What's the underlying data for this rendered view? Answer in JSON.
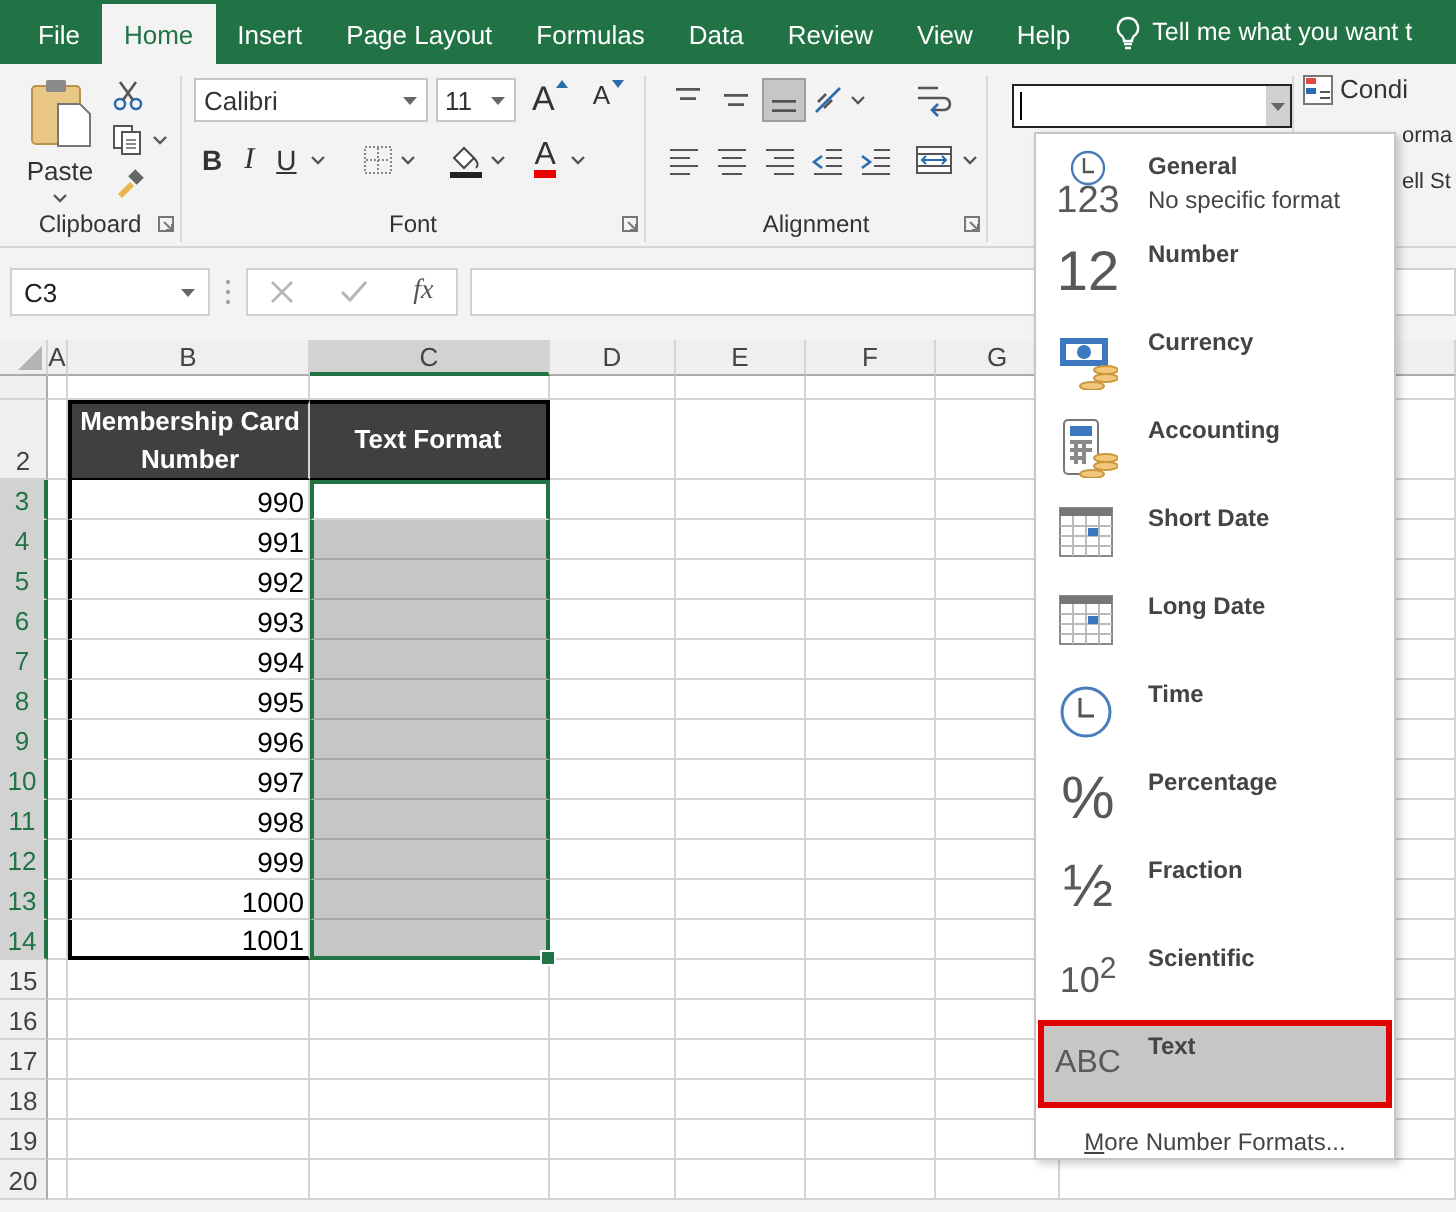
{
  "menu_tabs": [
    {
      "label": "File",
      "selected": false
    },
    {
      "label": "Home",
      "selected": true
    },
    {
      "label": "Insert",
      "selected": false
    },
    {
      "label": "Page Layout",
      "selected": false
    },
    {
      "label": "Formulas",
      "selected": false
    },
    {
      "label": "Data",
      "selected": false
    },
    {
      "label": "Review",
      "selected": false
    },
    {
      "label": "View",
      "selected": false
    },
    {
      "label": "Help",
      "selected": false
    }
  ],
  "tell_me": "Tell me what you want t",
  "ribbon": {
    "clipboard": {
      "paste": "Paste",
      "label": "Clipboard"
    },
    "font": {
      "name": "Calibri",
      "size": "11",
      "grow": "A",
      "shrink": "A",
      "bold": "B",
      "italic": "I",
      "underline": "U",
      "color_letter": "A",
      "label": "Font"
    },
    "alignment": {
      "label": "Alignment",
      "vertical_align": [
        {
          "kind": "top",
          "selected": false
        },
        {
          "kind": "middle",
          "selected": false
        },
        {
          "kind": "bottom",
          "selected": true
        }
      ]
    },
    "styles": [
      "Condi",
      "orma",
      "ell St"
    ]
  },
  "formula_bar": {
    "name_box": "C3",
    "fx": "fx"
  },
  "sheet": {
    "columns": [
      {
        "label": "A",
        "selected": false
      },
      {
        "label": "B",
        "selected": false
      },
      {
        "label": "C",
        "selected": true
      },
      {
        "label": "D",
        "selected": false
      },
      {
        "label": "E",
        "selected": false
      },
      {
        "label": "F",
        "selected": false
      },
      {
        "label": "G",
        "selected": false
      }
    ],
    "row_headers": [
      {
        "label": "2",
        "selected": false
      },
      {
        "label": "3",
        "selected": true
      },
      {
        "label": "4",
        "selected": true
      },
      {
        "label": "5",
        "selected": true
      },
      {
        "label": "6",
        "selected": true
      },
      {
        "label": "7",
        "selected": true
      },
      {
        "label": "8",
        "selected": true
      },
      {
        "label": "9",
        "selected": true
      },
      {
        "label": "10",
        "selected": true
      },
      {
        "label": "11",
        "selected": true
      },
      {
        "label": "12",
        "selected": true
      },
      {
        "label": "13",
        "selected": true
      },
      {
        "label": "14",
        "selected": true
      },
      {
        "label": "15",
        "selected": false
      },
      {
        "label": "16",
        "selected": false
      },
      {
        "label": "17",
        "selected": false
      },
      {
        "label": "18",
        "selected": false
      },
      {
        "label": "19",
        "selected": false
      },
      {
        "label": "20",
        "selected": false
      }
    ],
    "table": {
      "headers": [
        "Membership Card Number",
        "Text Format"
      ],
      "rows": [
        {
          "card_number": "990",
          "selected": true,
          "active": true
        },
        {
          "card_number": "991",
          "selected": true,
          "active": false
        },
        {
          "card_number": "992",
          "selected": true,
          "active": false
        },
        {
          "card_number": "993",
          "selected": true,
          "active": false
        },
        {
          "card_number": "994",
          "selected": true,
          "active": false
        },
        {
          "card_number": "995",
          "selected": true,
          "active": false
        },
        {
          "card_number": "996",
          "selected": true,
          "active": false
        },
        {
          "card_number": "997",
          "selected": true,
          "active": false
        },
        {
          "card_number": "998",
          "selected": true,
          "active": false
        },
        {
          "card_number": "999",
          "selected": true,
          "active": false
        },
        {
          "card_number": "1000",
          "selected": true,
          "active": false
        },
        {
          "card_number": "1001",
          "selected": true,
          "active": false
        }
      ]
    }
  },
  "format_menu": {
    "items": [
      {
        "kind": "general",
        "label": "General",
        "description": "No specific format",
        "glyph": "123",
        "selected": false
      },
      {
        "kind": "number",
        "label": "Number",
        "glyph": "12",
        "selected": false
      },
      {
        "kind": "currency",
        "label": "Currency",
        "selected": false
      },
      {
        "kind": "accounting",
        "label": "Accounting",
        "selected": false
      },
      {
        "kind": "short_date",
        "label": "Short Date",
        "selected": false
      },
      {
        "kind": "long_date",
        "label": "Long Date",
        "selected": false
      },
      {
        "kind": "time",
        "label": "Time",
        "selected": false
      },
      {
        "kind": "percentage",
        "label": "Percentage",
        "glyph": "%",
        "selected": false
      },
      {
        "kind": "fraction",
        "label": "Fraction",
        "glyph": "½",
        "selected": false
      },
      {
        "kind": "scientific",
        "label": "Scientific",
        "glyph": "10$^{2}$",
        "selected": false
      },
      {
        "kind": "text",
        "label": "Text",
        "glyph": "ABC",
        "selected": true
      }
    ],
    "more": "More Number Formats..."
  }
}
